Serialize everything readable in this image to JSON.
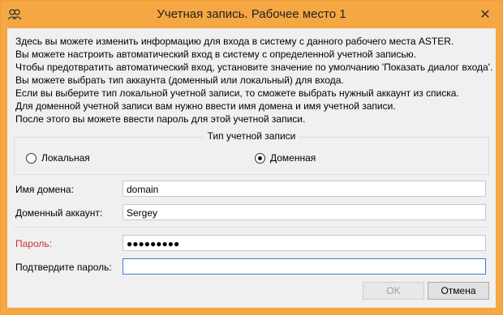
{
  "window": {
    "title": "Учетная запись. Рабочее место 1",
    "app_icon": "people-icon",
    "close_label": "✕"
  },
  "info_lines": [
    "Здесь вы можете изменить информацию для входа в систему с данного рабочего места ASTER.",
    "Вы можете настроить автоматический вход в систему с определенной учетной записью.",
    "Чтобы предотвратить автоматический вход, установите значение по умолчанию 'Показать диалог входа'.",
    "Вы можете выбрать тип аккаунта (доменный или локальный) для входа.",
    "Если вы выберите тип локальной учетной записи, то сможете выбрать нужный аккаунт из списка.",
    "Для доменной учетной записи вам нужно ввести имя домена и имя учетной записи.",
    "После этого вы можете ввести пароль для этой учетной записи."
  ],
  "account_type": {
    "title": "Тип учетной записи",
    "local_label": "Локальная",
    "domain_label": "Доменная",
    "selected": "domain"
  },
  "form": {
    "domain_label": "Имя домена:",
    "domain_value": "domain",
    "account_label": "Доменный аккаунт:",
    "account_value": "Sergey",
    "password_label": "Пароль:",
    "password_value": "●●●●●●●●●",
    "confirm_label": "Подтвердите пароль:",
    "confirm_value": ""
  },
  "buttons": {
    "ok_label": "OK",
    "cancel_label": "Отмена"
  },
  "colors": {
    "titlebar": "#f5a743",
    "error_label": "#d03030",
    "focus_border": "#3c7fd1"
  }
}
